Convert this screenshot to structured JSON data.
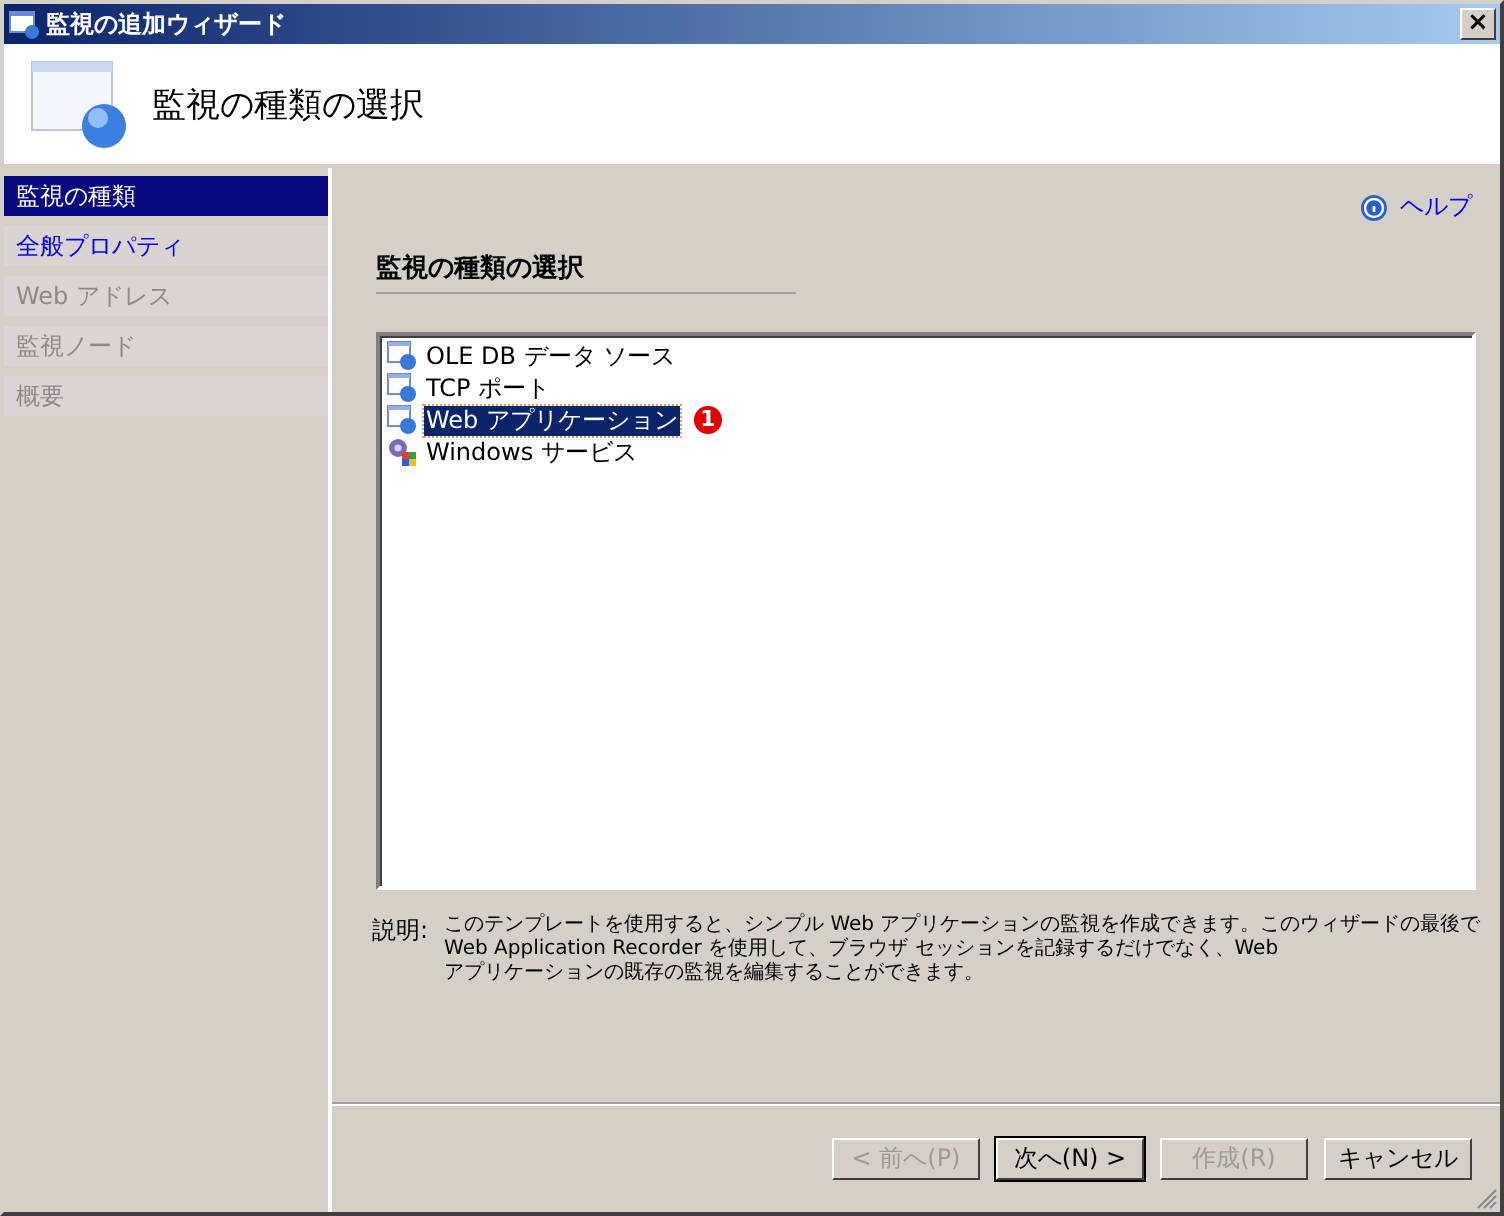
{
  "window": {
    "title": "監視の追加ウィザード",
    "close": "×"
  },
  "header": {
    "title": "監視の種類の選択"
  },
  "sidebar": {
    "items": [
      {
        "label": "監視の種類",
        "selected": true,
        "disabled": false
      },
      {
        "label": "全般プロパティ",
        "selected": false,
        "disabled": false
      },
      {
        "label": "Web アドレス",
        "selected": false,
        "disabled": true
      },
      {
        "label": "監視ノード",
        "selected": false,
        "disabled": true
      },
      {
        "label": "概要",
        "selected": false,
        "disabled": true
      }
    ]
  },
  "help": {
    "label": "ヘルプ"
  },
  "section": {
    "title": "監視の種類の選択"
  },
  "list": {
    "items": [
      {
        "label": "OLE DB データ ソース",
        "kind": "monitor",
        "selected": false
      },
      {
        "label": "TCP ポート",
        "kind": "monitor",
        "selected": false
      },
      {
        "label": "Web アプリケーション",
        "kind": "monitor",
        "selected": true,
        "callout": "1"
      },
      {
        "label": "Windows サービス",
        "kind": "service",
        "selected": false
      }
    ]
  },
  "description": {
    "label": "説明:",
    "lines": [
      "このテンプレートを使用すると、シンプル Web アプリケーションの監視を作成できます。このウィザードの最後で",
      "Web Application Recorder を使用して、ブラウザ セッションを記録するだけでなく、Web",
      "アプリケーションの既存の監視を編集することができます。"
    ]
  },
  "buttons": [
    {
      "label": "< 前へ(P)",
      "disabled": true,
      "default": false
    },
    {
      "label": "次へ(N) >",
      "disabled": false,
      "default": true
    },
    {
      "label": "作成(R)",
      "disabled": true,
      "default": false
    },
    {
      "label": "キャンセル",
      "disabled": false,
      "default": false
    }
  ]
}
